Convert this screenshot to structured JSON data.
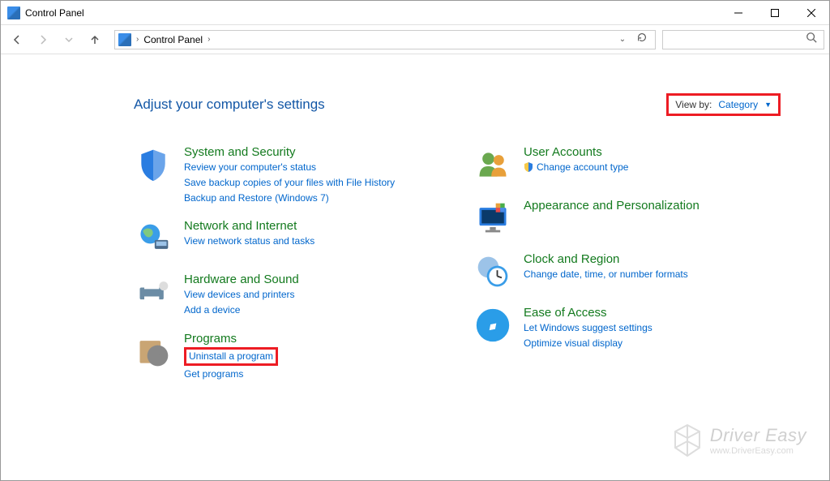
{
  "window": {
    "title": "Control Panel"
  },
  "address": {
    "root": "Control Panel",
    "sep": "›"
  },
  "search": {
    "placeholder": ""
  },
  "heading": "Adjust your computer's settings",
  "viewby": {
    "label": "View by:",
    "value": "Category"
  },
  "left": [
    {
      "title": "System and Security",
      "links": [
        "Review your computer's status",
        "Save backup copies of your files with File History",
        "Backup and Restore (Windows 7)"
      ]
    },
    {
      "title": "Network and Internet",
      "links": [
        "View network status and tasks"
      ]
    },
    {
      "title": "Hardware and Sound",
      "links": [
        "View devices and printers",
        "Add a device"
      ]
    },
    {
      "title": "Programs",
      "links": [
        "Uninstall a program",
        "Get programs"
      ]
    }
  ],
  "right": [
    {
      "title": "User Accounts",
      "links": [
        "Change account type"
      ],
      "shield": true
    },
    {
      "title": "Appearance and Personalization",
      "links": []
    },
    {
      "title": "Clock and Region",
      "links": [
        "Change date, time, or number formats"
      ]
    },
    {
      "title": "Ease of Access",
      "links": [
        "Let Windows suggest settings",
        "Optimize visual display"
      ]
    }
  ],
  "watermark": {
    "brand": "Driver Easy",
    "url": "www.DriverEasy.com"
  }
}
